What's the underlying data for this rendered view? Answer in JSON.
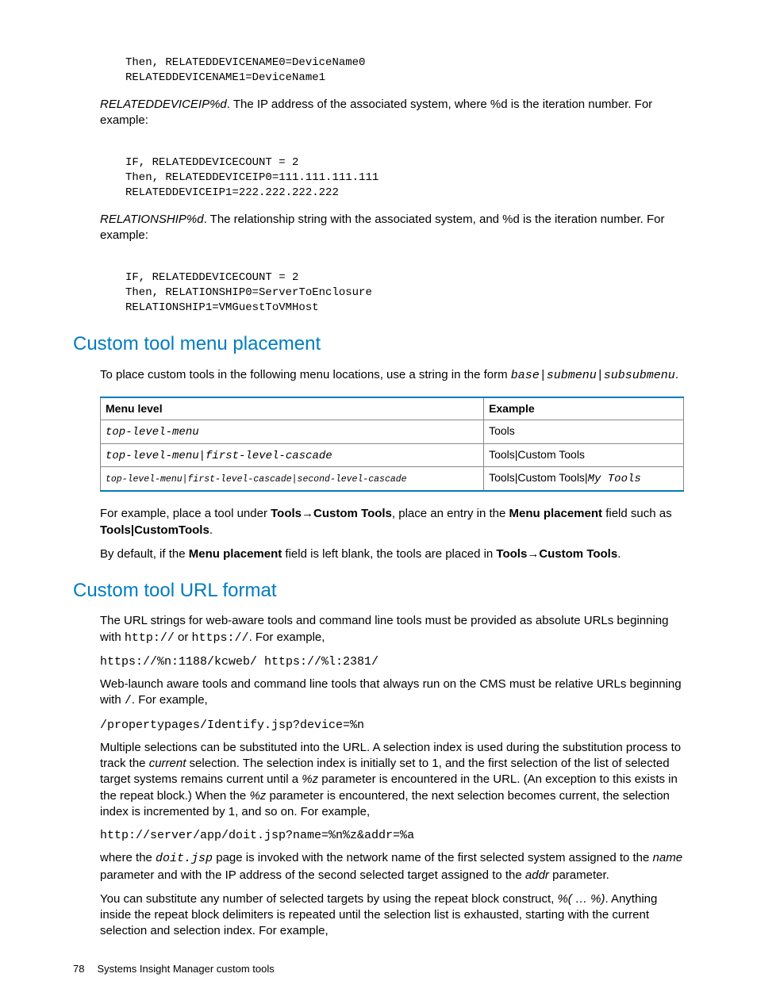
{
  "code1": "Then, RELATEDDEVICENAME0=DeviceName0\nRELATEDDEVICENAME1=DeviceName1",
  "para1_term": "RELATEDDEVICEIP%d",
  "para1_rest": ". The IP address of the associated system, where %d is the iteration number. For example:",
  "code2": "IF, RELATEDDEVICECOUNT = 2\nThen, RELATEDDEVICEIP0=111.111.111.111\nRELATEDDEVICEIP1=222.222.222.222",
  "para2_term": "RELATIONSHIP%d",
  "para2_rest": ". The relationship string with the associated system, and %d is the iteration number. For example:",
  "code3": "IF, RELATEDDEVICECOUNT = 2\nThen, RELATIONSHIP0=ServerToEnclosure\nRELATIONSHIP1=VMGuestToVMHost",
  "h1": "Custom tool menu placement",
  "para3a": "To place custom tools in the following menu locations, use a string in the form ",
  "para3b": "base|submenu|subsubmenu",
  "para3c": ".",
  "table": {
    "headers": [
      "Menu level",
      "Example"
    ],
    "rows": [
      {
        "level": "top-level-menu",
        "example": "Tools",
        "level_small": false
      },
      {
        "level": "top-level-menu|first-level-cascade",
        "example": "Tools|Custom Tools",
        "level_small": false
      },
      {
        "level": "top-level-menu|first-level-cascade|second-level-cascade",
        "example_pre": "Tools|Custom Tools|",
        "example_code": "My Tools",
        "level_small": true
      }
    ]
  },
  "para4_1": "For example, place a tool under ",
  "para4_b1": "Tools",
  "para4_arrow": "→",
  "para4_b2": "Custom Tools",
  "para4_2": ", place an entry in the ",
  "para4_b3": "Menu placement",
  "para4_3": " field such as ",
  "para4_b4": "Tools|CustomTools",
  "para4_4": ".",
  "para5_1": "By default, if the ",
  "para5_b1": "Menu placement",
  "para5_2": " field is left blank, the tools are placed in ",
  "para5_b2": "Tools",
  "para5_arrow": "→",
  "para5_b3": "Custom Tools",
  "para5_3": ".",
  "h2": "Custom tool URL format",
  "para6_1": "The URL strings for web-aware tools and command line tools must be provided as absolute URLs beginning with ",
  "para6_c1": "http://",
  "para6_2": " or ",
  "para6_c2": "https://",
  "para6_3": ". For example,",
  "code4": "https://%n:1188/kcweb/ https://%l:2381/",
  "para7_1": "Web-launch aware tools and command line tools that always run on the CMS must be relative URLs beginning with ",
  "para7_c1": "/",
  "para7_2": ". For example,",
  "code5": "/propertypages/Identify.jsp?device=%n",
  "para8_1": "Multiple selections can be substituted into the URL. A selection index is used during the substitution process to track the ",
  "para8_i1": "current",
  "para8_2": " selection. The selection index is initially set to 1, and the first selection of the list of selected target systems remains current until a ",
  "para8_i2": "%z",
  "para8_3": " parameter is encountered in the URL. (An exception to this exists in the repeat block.) When the ",
  "para8_i3": "%z",
  "para8_4": " parameter is encountered, the next selection becomes current, the selection index is incremented by 1, and so on. For example,",
  "code6": "http://server/app/doit.jsp?name=%n%z&addr=%a",
  "para9_1": "where the ",
  "para9_c1": "doit.jsp",
  "para9_2": " page is invoked with the network name of the first selected system assigned to the ",
  "para9_i1": "name",
  "para9_3": " parameter and with the IP address of the second selected target assigned to the ",
  "para9_i2": "addr",
  "para9_4": " parameter.",
  "para10_1": "You can substitute any number of selected targets by using the repeat block construct, ",
  "para10_i1": "%( … %)",
  "para10_2": ". Anything inside the repeat block delimiters is repeated until the selection list is exhausted, starting with the current selection and selection index. For example,",
  "footer_page": "78",
  "footer_text": "Systems Insight Manager custom tools"
}
